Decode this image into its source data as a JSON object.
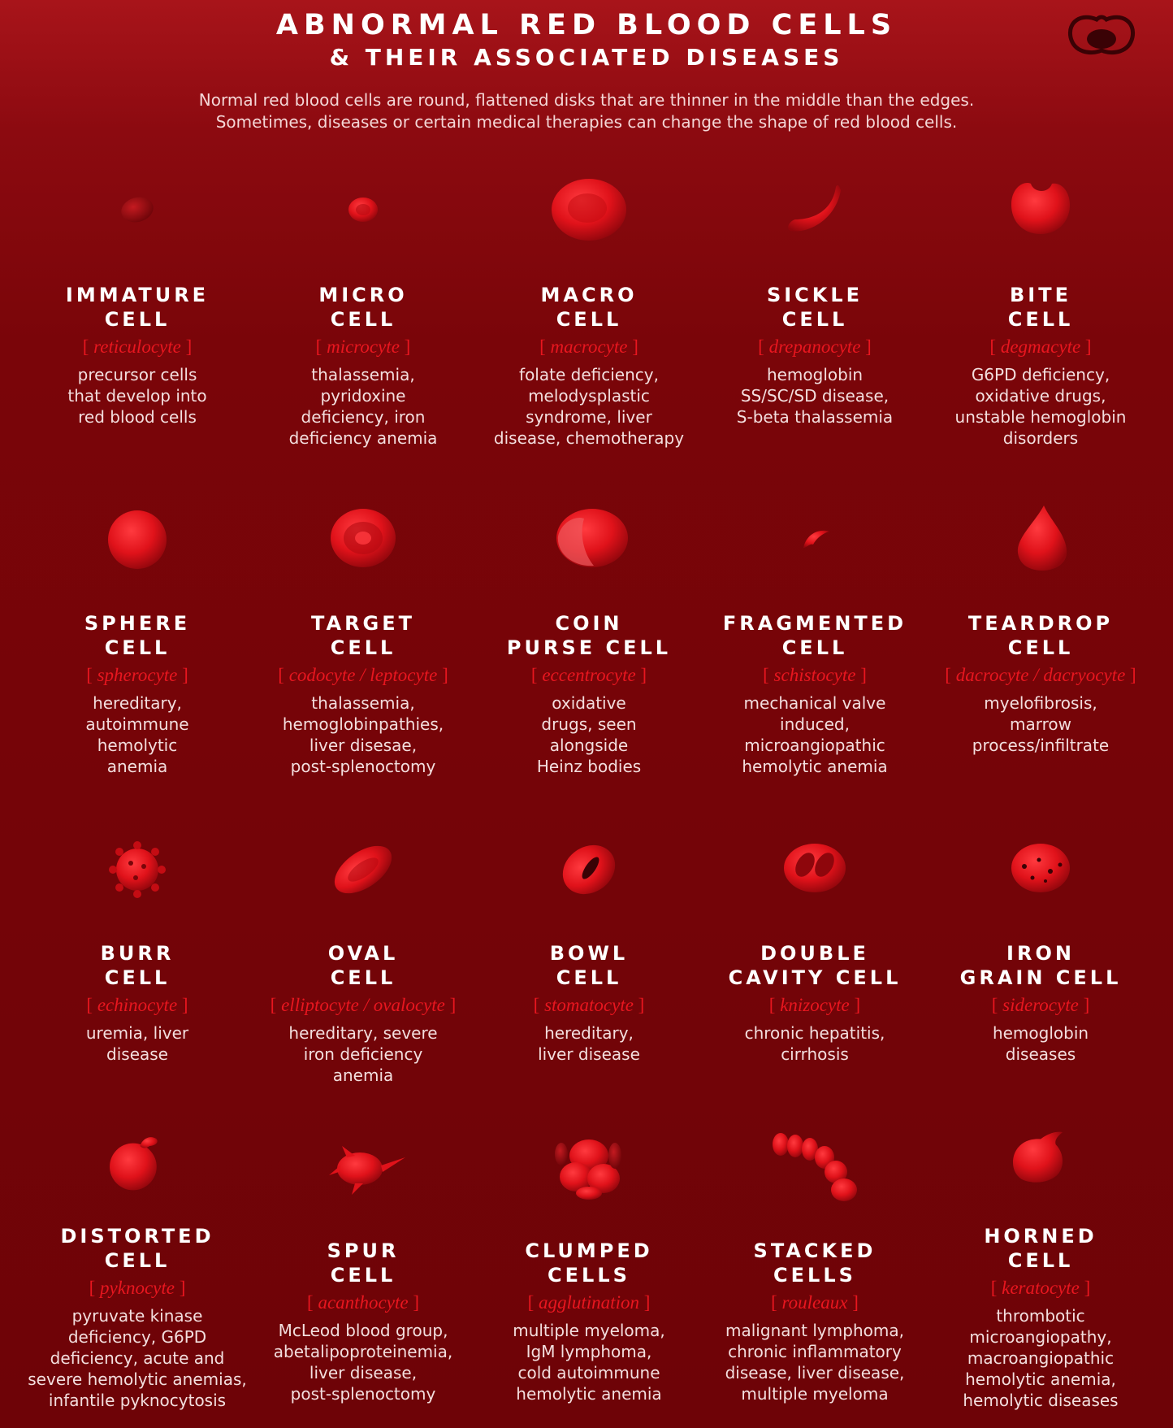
{
  "header": {
    "title": "ABNORMAL RED BLOOD CELLS",
    "subtitle": "& THEIR ASSOCIATED DISEASES",
    "intro_line1": "Normal red blood cells are round, flattened disks that are thinner in the middle than the edges.",
    "intro_line2": "Sometimes, diseases or certain medical therapies can change the shape of red blood cells."
  },
  "cells": [
    {
      "name": "IMMATURE\nCELL",
      "sci": "reticulocyte",
      "desc": "precursor cells\nthat develop into\nred blood cells",
      "icon": "immature-cell-icon"
    },
    {
      "name": "MICRO\nCELL",
      "sci": "microcyte",
      "desc": "thalassemia,\npyridoxine\ndeficiency, iron\ndeficiency anemia",
      "icon": "micro-cell-icon"
    },
    {
      "name": "MACRO\nCELL",
      "sci": "macrocyte",
      "desc": "folate deficiency,\nmelodysplastic\nsyndrome, liver\ndisease, chemotherapy",
      "icon": "macro-cell-icon"
    },
    {
      "name": "SICKLE\nCELL",
      "sci": "drepanocyte",
      "desc": "hemoglobin\nSS/SC/SD disease,\nS-beta thalassemia",
      "icon": "sickle-cell-icon"
    },
    {
      "name": "BITE\nCELL",
      "sci": "degmacyte",
      "desc": "G6PD deficiency,\noxidative drugs,\nunstable hemoglobin\ndisorders",
      "icon": "bite-cell-icon"
    },
    {
      "name": "SPHERE\nCELL",
      "sci": "spherocyte",
      "desc": "hereditary,\nautoimmune\nhemolytic\nanemia",
      "icon": "sphere-cell-icon"
    },
    {
      "name": "TARGET\nCELL",
      "sci": "codocyte / leptocyte",
      "desc": "thalassemia,\nhemoglobinpathies,\nliver disesae,\npost-splenoctomy",
      "icon": "target-cell-icon"
    },
    {
      "name": "COIN\nPURSE CELL",
      "sci": "eccentrocyte",
      "desc": "oxidative\ndrugs, seen\nalongside\nHeinz bodies",
      "icon": "coin-purse-cell-icon"
    },
    {
      "name": "FRAGMENTED\nCELL",
      "sci": "schistocyte",
      "desc": "mechanical valve\ninduced,\nmicroangiopathic\nhemolytic anemia",
      "icon": "fragmented-cell-icon"
    },
    {
      "name": "TEARDROP\nCELL",
      "sci": "dacrocyte / dacryocyte",
      "desc": "myelofibrosis,\nmarrow\nprocess/infiltrate",
      "icon": "teardrop-cell-icon"
    },
    {
      "name": "BURR\nCELL",
      "sci": "echinocyte",
      "desc": "uremia, liver\ndisease",
      "icon": "burr-cell-icon"
    },
    {
      "name": "OVAL\nCELL",
      "sci": "elliptocyte / ovalocyte",
      "desc": "hereditary, severe\niron deficiency\nanemia",
      "icon": "oval-cell-icon"
    },
    {
      "name": "BOWL\nCELL",
      "sci": "stomatocyte",
      "desc": "hereditary,\nliver disease",
      "icon": "bowl-cell-icon"
    },
    {
      "name": "DOUBLE\nCAVITY CELL",
      "sci": "knizocyte",
      "desc": "chronic hepatitis,\ncirrhosis",
      "icon": "double-cavity-cell-icon"
    },
    {
      "name": "IRON\nGRAIN CELL",
      "sci": "siderocyte",
      "desc": "hemoglobin\ndiseases",
      "icon": "iron-grain-cell-icon"
    },
    {
      "name": "DISTORTED\nCELL",
      "sci": "pyknocyte",
      "desc": "pyruvate kinase\ndeficiency, G6PD\ndeficiency, acute and\nsevere hemolytic anemias,\ninfantile pyknocytosis",
      "icon": "distorted-cell-icon"
    },
    {
      "name": "SPUR\nCELL",
      "sci": "acanthocyte",
      "desc": "McLeod blood group,\nabetalipoproteinemia,\nliver disease,\npost-splenoctomy",
      "icon": "spur-cell-icon"
    },
    {
      "name": "CLUMPED\nCELLS",
      "sci": "agglutination",
      "desc": "multiple myeloma,\nIgM lymphoma,\ncold autoimmune\nhemolytic anemia",
      "icon": "clumped-cells-icon"
    },
    {
      "name": "STACKED\nCELLS",
      "sci": "rouleaux",
      "desc": "malignant lymphoma,\nchronic inflammatory\ndisease, liver disease,\nmultiple myeloma",
      "icon": "stacked-cells-icon"
    },
    {
      "name": "HORNED\nCELL",
      "sci": "keratocyte",
      "desc": "thrombotic\nmicroangiopathy,\nmacroangiopathic\nhemolytic anemia,\nhemolytic diseases",
      "icon": "horned-cell-icon"
    }
  ],
  "colors": {
    "accent": "#e8161f",
    "cell": "#e0121a",
    "background": "#7a0509"
  }
}
